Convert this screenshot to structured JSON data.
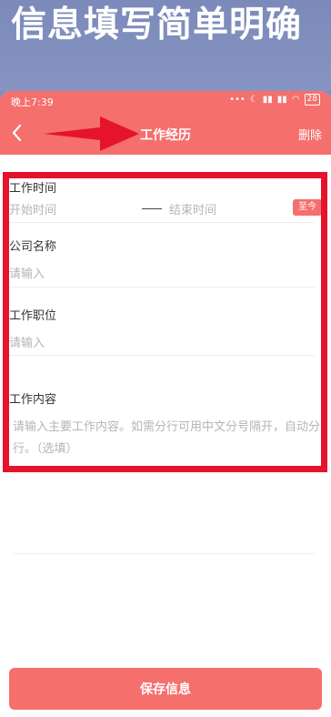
{
  "banner": {
    "title": "信息填写简单明确"
  },
  "status_bar": {
    "time": "晚上7:39",
    "battery": "28"
  },
  "navbar": {
    "title": "工作经历",
    "right_action": "删除"
  },
  "form": {
    "work_time": {
      "label": "工作时间",
      "start_placeholder": "开始时间",
      "end_placeholder": "结束时间",
      "to_now": "至今"
    },
    "company": {
      "label": "公司名称",
      "placeholder": "请输入"
    },
    "position": {
      "label": "工作职位",
      "placeholder": "请输入"
    },
    "content": {
      "label": "工作内容",
      "placeholder": "请输入主要工作内容。如需分行可用中文分号隔开，自动分行。（选填）"
    }
  },
  "footer": {
    "save_label": "保存信息"
  },
  "colors": {
    "accent": "#f56f6c",
    "highlight": "#e5132b",
    "banner_bg": "#7f8ebb"
  }
}
